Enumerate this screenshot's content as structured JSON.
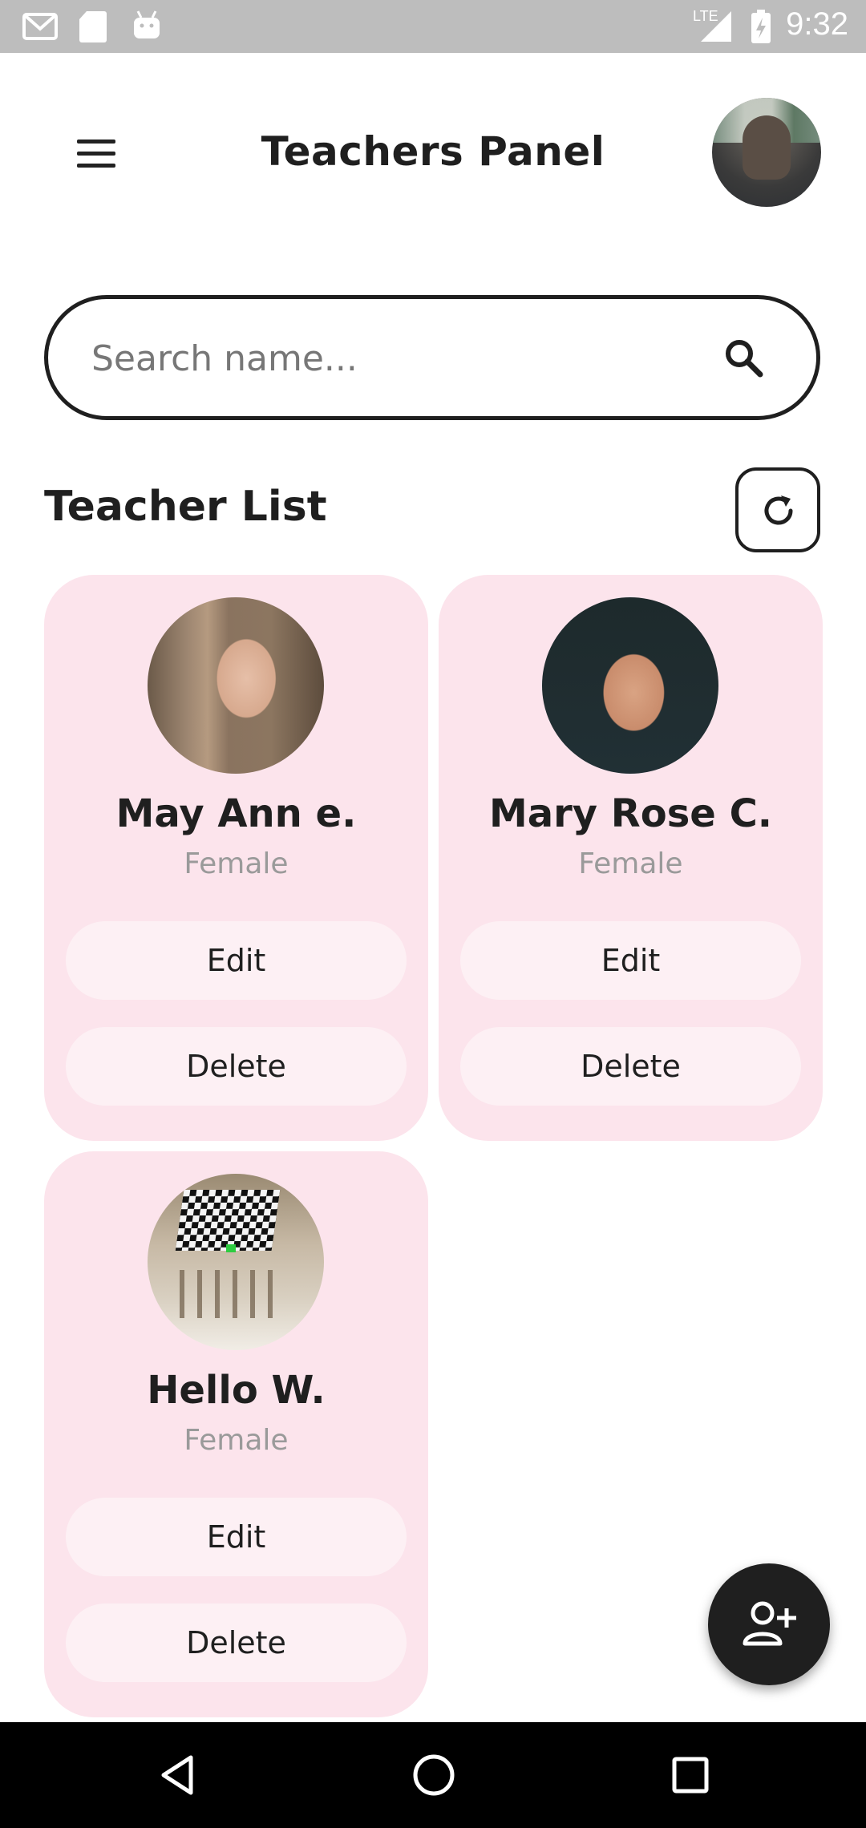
{
  "status_bar": {
    "time": "9:32",
    "network": "LTE",
    "icons": [
      "gmail-icon",
      "sd-card-icon",
      "android-icon",
      "signal-icon",
      "battery-charging-icon"
    ]
  },
  "app_bar": {
    "title": "Teachers Panel",
    "menu_icon": "menu-icon",
    "avatar": "profile-avatar"
  },
  "search": {
    "placeholder": "Search name...",
    "value": "",
    "icon": "search-icon"
  },
  "section": {
    "title": "Teacher List",
    "refresh_icon": "refresh-icon"
  },
  "teachers": [
    {
      "name": "May Ann e.",
      "gender": "Female",
      "edit_label": "Edit",
      "delete_label": "Delete"
    },
    {
      "name": "Mary Rose C.",
      "gender": "Female",
      "edit_label": "Edit",
      "delete_label": "Delete"
    },
    {
      "name": "Hello W.",
      "gender": "Female",
      "edit_label": "Edit",
      "delete_label": "Delete"
    }
  ],
  "fab": {
    "icon": "add-person-icon"
  },
  "nav_bar": {
    "icons": [
      "back-icon",
      "home-icon",
      "recents-icon"
    ]
  },
  "colors": {
    "card_bg": "#fce4ec",
    "button_bg": "#fdf0f4",
    "text": "#1f1f1f",
    "muted": "#9a9a9a",
    "status_bar": "#bdbdbd"
  }
}
